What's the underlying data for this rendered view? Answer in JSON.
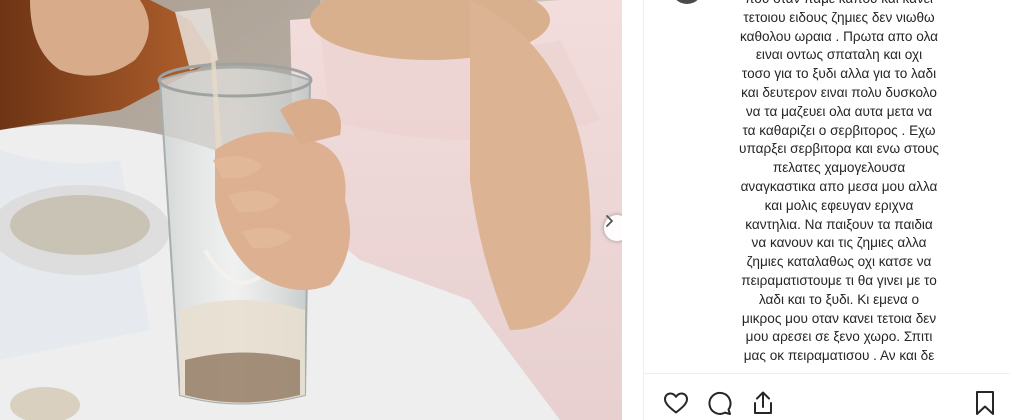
{
  "post": {
    "comment_lines": [
      "που οταν παμε καπου και κανει",
      "τετοιου ειδους ζημιες δεν νιωθω",
      "καθολου ωραια . Πρωτα απο ολα",
      "ειναι οντως σπαταλη και οχι",
      "τοσο για το ξυδι αλλα για το λαδι",
      "και δευτερον ειναι πολυ δυσκολο",
      "να τα μαζευει ολα αυτα μετα να",
      "τα καθαριζει ο σερβιτορος . Εχω",
      "υπαρξει σερβιτορα και ενω στους",
      "πελατες χαμογελουσα",
      "αναγκαστικα απο μεσα μου αλλα",
      "και μολις εφευγαν εριχνα",
      "καντηλια. Να παιξουν τα παιδια",
      "να κανουν και τις ζημιες αλλα",
      "ζημιες καταλαθως οχι κατσε να",
      "πειραματιστουμε τι θα γινει με το",
      "λαδι και το ξυδι. Κι εμενα ο",
      "μικρος μου οταν κανει τετοια δεν",
      "μου αρεσει σε ξενο χωρο. Σπιτι",
      "μας οκ πειραματισου . Αν και δε"
    ]
  },
  "icons": {
    "next": "chevron-right-icon",
    "like": "heart-icon",
    "comment": "comment-bubble-icon",
    "share": "share-icon",
    "save": "bookmark-icon"
  }
}
